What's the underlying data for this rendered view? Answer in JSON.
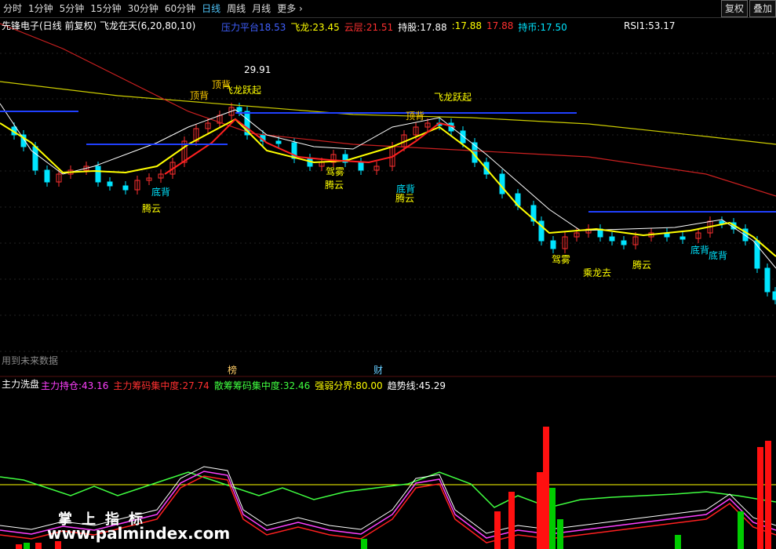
{
  "toolbar": {
    "tabs": [
      "分时",
      "1分钟",
      "5分钟",
      "15分钟",
      "30分钟",
      "60分钟",
      "日线",
      "周线",
      "月线",
      "更多"
    ],
    "active_tab": "日线",
    "more_icon": "chevron-right-icon",
    "right_buttons": [
      "复权",
      "叠加"
    ]
  },
  "header": {
    "stock": "先锋电子(日线 前复权)",
    "indicator": "飞龙在天(6,20,80,10)",
    "items": [
      {
        "label": "压力平台",
        "value": "18.53",
        "color": "#4060ff"
      },
      {
        "label": "飞龙:",
        "value": "23.45",
        "color": "#ffff00"
      },
      {
        "label": "云层:",
        "value": "21.51",
        "color": "#ff3030"
      },
      {
        "label": "持股:",
        "value": "17.88",
        "color": "#ffffff"
      },
      {
        "label": ":",
        "value": "17.88",
        "color": "#ffff00"
      },
      {
        "label": "",
        "value": "17.88",
        "color": "#ff3030"
      },
      {
        "label": "持币:",
        "value": "17.50",
        "color": "#00e5ff"
      }
    ],
    "rsi_label": "RSI1:",
    "rsi_value": "53.17"
  },
  "annotations": {
    "peak_price": "29.91",
    "top_back": "顶背",
    "dragon_fly": "飞龙跃起",
    "bottom_back": "底背",
    "cloud_up": "腾云",
    "fog": "驾雾",
    "dragon_away": "乘龙去"
  },
  "lower_title": {
    "future_note": "用到未来数据",
    "bang_marker": "榜",
    "cai_marker": "财",
    "indicator": "主力洗盘",
    "items": [
      {
        "label": "主力持仓:",
        "value": "43.16",
        "color": "#ff40ff"
      },
      {
        "label": "主力筹码集中度:",
        "value": "27.74",
        "color": "#ff3030"
      },
      {
        "label": "散筹筹码集中度:",
        "value": "32.46",
        "color": "#40ff40"
      },
      {
        "label": "强弱分界:",
        "value": "80.00",
        "color": "#ffff00"
      },
      {
        "label": "趋势线:",
        "value": "45.29",
        "color": "#ffffff"
      }
    ]
  },
  "watermark": {
    "title": "掌上指标",
    "url": "www.palmindex.com"
  },
  "colors": {
    "up": "#ff3030",
    "down": "#00e5ff",
    "yellow": "#ffff00",
    "blue": "#2040ff",
    "green": "#40ff40",
    "magenta": "#ff40ff"
  }
}
